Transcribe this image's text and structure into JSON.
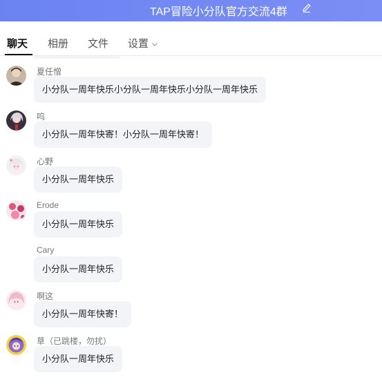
{
  "header": {
    "title": "TAP冒险小分队官方交流4群"
  },
  "tabs": [
    {
      "label": "聊天"
    },
    {
      "label": "相册"
    },
    {
      "label": "文件"
    },
    {
      "label": "设置"
    }
  ],
  "messages": [
    {
      "sender": "夏任憎",
      "text": "小分队一周年快乐小分队一周年快乐小分队一周年快乐"
    },
    {
      "sender": "呜",
      "text": "小分队一周年快寄！小分队一周年快寄！"
    },
    {
      "sender": "心野",
      "text": "小分队一周年快乐"
    },
    {
      "sender": "Erode",
      "text": "小分队一周年快乐"
    },
    {
      "sender": "Cary",
      "text": "小分队一周年快乐"
    },
    {
      "sender": "啊这",
      "text": "小分队一周年快寄！"
    },
    {
      "sender": "草（已跳楼，勿扰）",
      "text": "小分队一周年快乐"
    }
  ],
  "colors": {
    "header": "#6b83f0",
    "bubble": "#f3f4f8"
  },
  "icons": {
    "edit": "edit-icon",
    "dropdown": "chevron-down-icon"
  }
}
